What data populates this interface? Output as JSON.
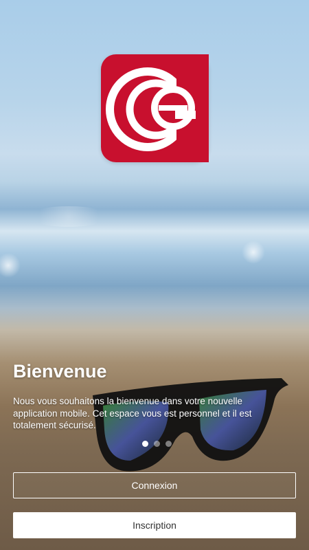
{
  "welcome": {
    "title": "Bienvenue",
    "description": "Nous vous souhaitons la bienvenue dans votre nouvelle application mobile. Cet espace vous est personnel et il est totalement sécurisé."
  },
  "carousel": {
    "total_pages": 3,
    "active_page": 1
  },
  "actions": {
    "login_label": "Connexion",
    "signup_label": "Inscription"
  },
  "logo": {
    "icon": "ce-logo-icon",
    "brand_color": "#c8102e"
  }
}
